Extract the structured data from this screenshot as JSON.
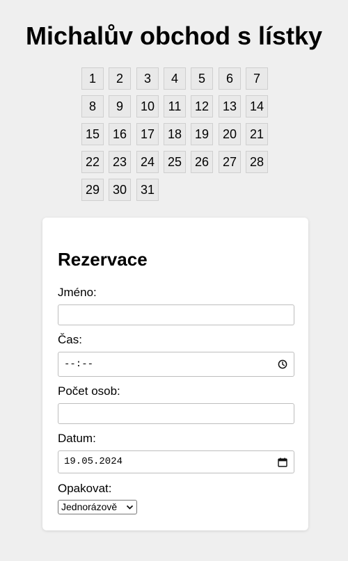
{
  "page_title": "Michalův obchod s lístky",
  "calendar": {
    "days": [
      "1",
      "2",
      "3",
      "4",
      "5",
      "6",
      "7",
      "8",
      "9",
      "10",
      "11",
      "12",
      "13",
      "14",
      "15",
      "16",
      "17",
      "18",
      "19",
      "20",
      "21",
      "22",
      "23",
      "24",
      "25",
      "26",
      "27",
      "28",
      "29",
      "30",
      "31"
    ]
  },
  "form": {
    "heading": "Rezervace",
    "name_label": "Jméno:",
    "name_value": "",
    "time_label": "Čas:",
    "time_value": "--:--",
    "persons_label": "Počet osob:",
    "persons_value": "",
    "date_label": "Datum:",
    "date_value": "19.05.2024",
    "repeat_label": "Opakovat:",
    "repeat_value": "Jednorázově"
  }
}
